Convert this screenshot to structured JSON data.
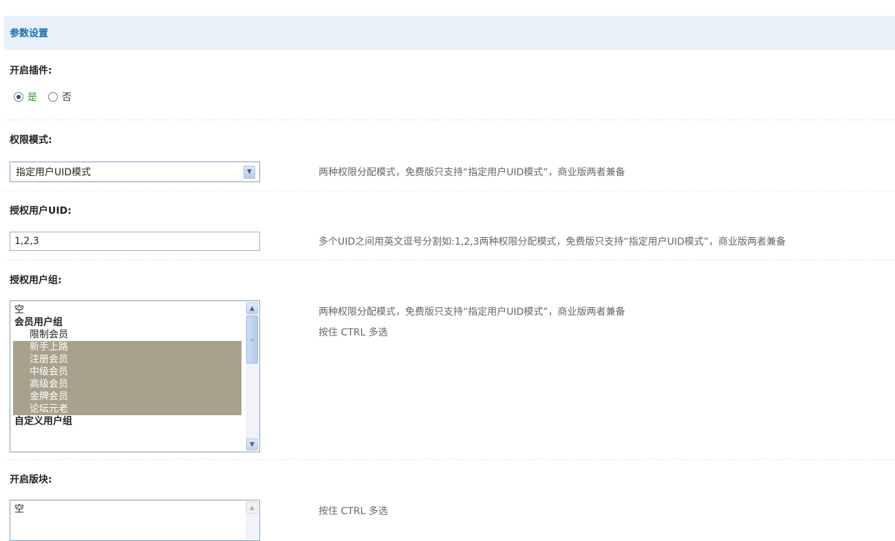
{
  "header": {
    "title": "参数设置"
  },
  "enable_plugin": {
    "label": "开启插件:",
    "options": [
      {
        "label": "是",
        "checked": true
      },
      {
        "label": "否",
        "checked": false
      }
    ]
  },
  "permission_mode": {
    "label": "权限模式:",
    "selected": "指定用户UID模式",
    "hint": "两种权限分配模式，免费版只支持“指定用户UID模式”，商业版两者兼备"
  },
  "authorized_uid": {
    "label": "授权用户UID:",
    "value": "1,2,3",
    "hint": "多个UID之间用英文逗号分割如:1,2,3两种权限分配模式，免费版只支持“指定用户UID模式”，商业版两者兼备"
  },
  "authorized_groups": {
    "label": "授权用户组:",
    "hint_1": "两种权限分配模式，免费版只支持“指定用户UID模式”，商业版两者兼备",
    "hint_2": "按住 CTRL 多选",
    "options": [
      {
        "label": "空",
        "kind": "plain",
        "selected": false
      },
      {
        "label": "会员用户组",
        "kind": "group",
        "selected": false
      },
      {
        "label": "限制会员",
        "kind": "child",
        "selected": false
      },
      {
        "label": "新手上路",
        "kind": "child",
        "selected": true
      },
      {
        "label": "注册会员",
        "kind": "child",
        "selected": true
      },
      {
        "label": "中级会员",
        "kind": "child",
        "selected": true
      },
      {
        "label": "高级会员",
        "kind": "child",
        "selected": true
      },
      {
        "label": "金牌会员",
        "kind": "child",
        "selected": true
      },
      {
        "label": "论坛元老",
        "kind": "child",
        "selected": true
      },
      {
        "label": "自定义用户组",
        "kind": "group",
        "selected": false
      }
    ]
  },
  "enable_forums": {
    "label": "开启版块:",
    "hint": "按住 CTRL 多选",
    "options": [
      {
        "label": "空",
        "kind": "plain",
        "selected": false
      }
    ]
  },
  "colors": {
    "header_bg": "#e8f1fa",
    "header_text": "#1a6fb0",
    "selected_option_bg": "#a8a18c"
  }
}
